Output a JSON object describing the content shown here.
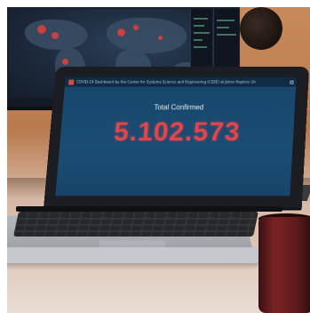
{
  "screen": {
    "window_title": "COVID-19 Dashboard by the Center for Systems Science and Engineering (CSSE) at Johns Hopkins Un",
    "total_label": "Total Confirmed",
    "total_value": "5.102.573"
  },
  "colors": {
    "dashboard_background": "#1a4d74",
    "value_red": "#e2454b",
    "mug_red": "#7a2424"
  },
  "icons": {
    "app": "dashboard-app-icon",
    "window_control": "maximize-icon"
  }
}
